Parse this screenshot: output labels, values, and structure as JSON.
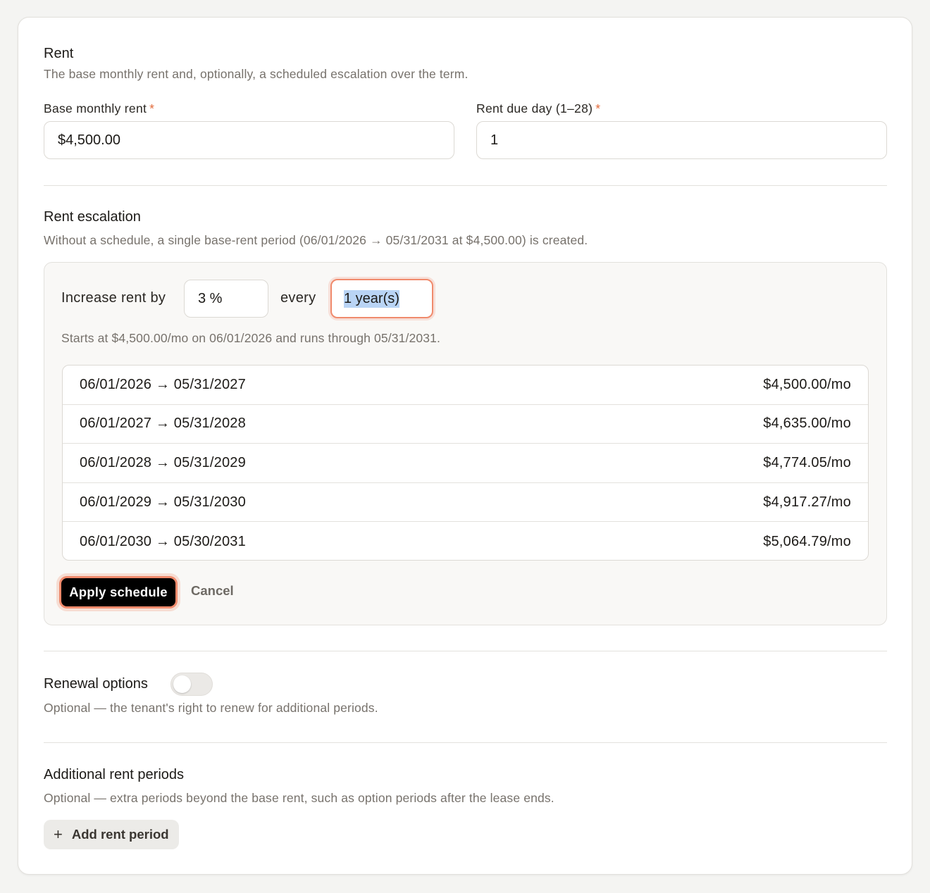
{
  "rent": {
    "title": "Rent",
    "subtitle": "The base monthly rent and, optionally, a scheduled escalation over the term.",
    "base_label": "Base monthly rent",
    "base_value": "$4,500.00",
    "due_label": "Rent due day (1–28)",
    "due_value": "1",
    "required_mark": "*"
  },
  "escalation": {
    "title": "Rent escalation",
    "subtitle": "Without a schedule, a single base-rent period (06/01/2026 → 05/31/2031 at $4,500.00) is created.",
    "increase_label": "Increase rent by",
    "percent_value": "3 %",
    "every_label": "every",
    "period_value": "1 year(s)",
    "summary": "Starts at $4,500.00/mo on 06/01/2026 and runs through 05/31/2031.",
    "schedule": [
      {
        "range": "06/01/2026 → 05/31/2027",
        "amount": "$4,500.00/mo"
      },
      {
        "range": "06/01/2027 → 05/31/2028",
        "amount": "$4,635.00/mo"
      },
      {
        "range": "06/01/2028 → 05/31/2029",
        "amount": "$4,774.05/mo"
      },
      {
        "range": "06/01/2029 → 05/31/2030",
        "amount": "$4,917.27/mo"
      },
      {
        "range": "06/01/2030 → 05/30/2031",
        "amount": "$5,064.79/mo"
      }
    ],
    "apply_label": "Apply schedule",
    "cancel_label": "Cancel"
  },
  "renewal": {
    "title": "Renewal options",
    "subtitle": "Optional — the tenant's right to renew for additional periods.",
    "enabled": false
  },
  "additional": {
    "title": "Additional rent periods",
    "subtitle": "Optional — extra periods beyond the base rent, such as option periods after the lease ends.",
    "add_label": "Add rent period",
    "add_icon": "plus-icon"
  },
  "colors": {
    "accent": "#f08a6c",
    "required": "#e26a3a",
    "selection": "#b9d4f5"
  }
}
